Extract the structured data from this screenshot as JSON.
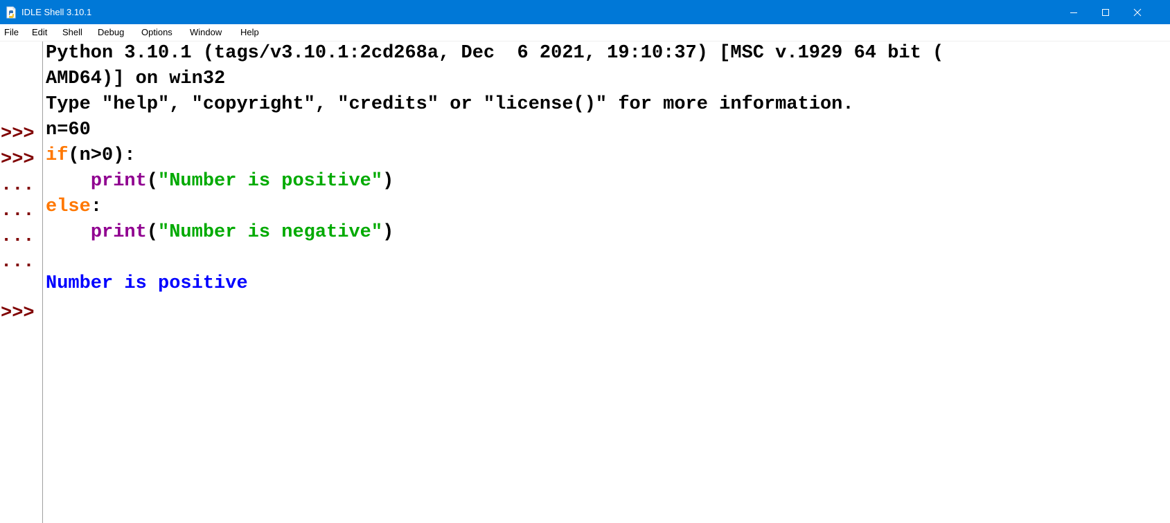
{
  "window": {
    "title": "IDLE Shell 3.10.1",
    "controls": {
      "minimize_icon": "minimize-icon",
      "maximize_icon": "maximize-icon",
      "close_icon": "close-icon"
    }
  },
  "menu": {
    "items": [
      "File",
      "Edit",
      "Shell",
      "Debug",
      "Options",
      "Window",
      "Help"
    ]
  },
  "colors": {
    "titlebar": "#0078d7",
    "prompt": "#7f0000",
    "keyword": "#ff7700",
    "builtin": "#900090",
    "string": "#00aa00",
    "output": "#0000ff"
  },
  "shell": {
    "banner": {
      "line1": "Python 3.10.1 (tags/v3.10.1:2cd268a, Dec  6 2021, 19:10:37) [MSC v.1929 64 bit (",
      "line2": "AMD64)] on win32",
      "line3": "Type \"help\", \"copyright\", \"credits\" or \"license()\" for more information."
    },
    "prompts": {
      "primary": ">>>",
      "continuation": "..."
    },
    "code": {
      "line1": "n=60",
      "line2_kw": "if",
      "line2_rest": "(n>0):",
      "line3_indent": "    ",
      "line3_fn": "print",
      "line3_open": "(",
      "line3_str": "\"Number is positive\"",
      "line3_close": ")",
      "line4_kw": "else",
      "line4_rest": ":",
      "line5_indent": "    ",
      "line5_fn": "print",
      "line5_open": "(",
      "line5_str": "\"Number is negative\"",
      "line5_close": ")"
    },
    "output": "Number is positive"
  }
}
